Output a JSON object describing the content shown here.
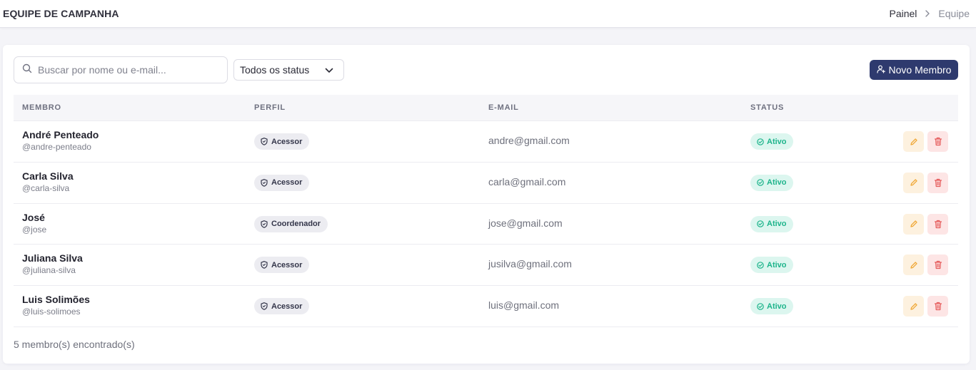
{
  "header": {
    "title": "EQUIPE DE CAMPANHA",
    "breadcrumb": {
      "parent": "Painel",
      "current": "Equipe"
    }
  },
  "toolbar": {
    "search_placeholder": "Buscar por nome ou e-mail...",
    "search_value": "",
    "status_filter": "Todos os status",
    "new_member_label": "Novo Membro"
  },
  "table": {
    "columns": [
      "MEMBRO",
      "PERFIL",
      "E-MAIL",
      "STATUS"
    ],
    "rows": [
      {
        "name": "André Penteado",
        "username": "@andre-penteado",
        "role": "Acessor",
        "email": "andre@gmail.com",
        "status": "Ativo"
      },
      {
        "name": "Carla Silva",
        "username": "@carla-silva",
        "role": "Acessor",
        "email": "carla@gmail.com",
        "status": "Ativo"
      },
      {
        "name": "José",
        "username": "@jose",
        "role": "Coordenador",
        "email": "jose@gmail.com",
        "status": "Ativo"
      },
      {
        "name": "Juliana Silva",
        "username": "@juliana-silva",
        "role": "Acessor",
        "email": "jusilva@gmail.com",
        "status": "Ativo"
      },
      {
        "name": "Luis Solimões",
        "username": "@luis-solimoes",
        "role": "Acessor",
        "email": "luis@gmail.com",
        "status": "Ativo"
      }
    ]
  },
  "footer": {
    "count_text": "5 membro(s) encontrado(s)"
  },
  "icons": {
    "search": "search-icon",
    "chevron": "chevron-down-icon",
    "breadcrumb_sep": "chevron-right-icon",
    "new_member": "user-plus-icon",
    "role": "shield-icon",
    "status": "check-circle-icon",
    "edit": "pencil-icon",
    "delete": "trash-icon"
  },
  "colors": {
    "primary": "#2e3a6e",
    "status_active": "#1db48b",
    "status_active_bg": "#dcf6ef",
    "edit_bg": "#fdf1df",
    "edit_icon": "#f0a836",
    "delete_bg": "#fde5e5",
    "delete_icon": "#e55a5a"
  }
}
